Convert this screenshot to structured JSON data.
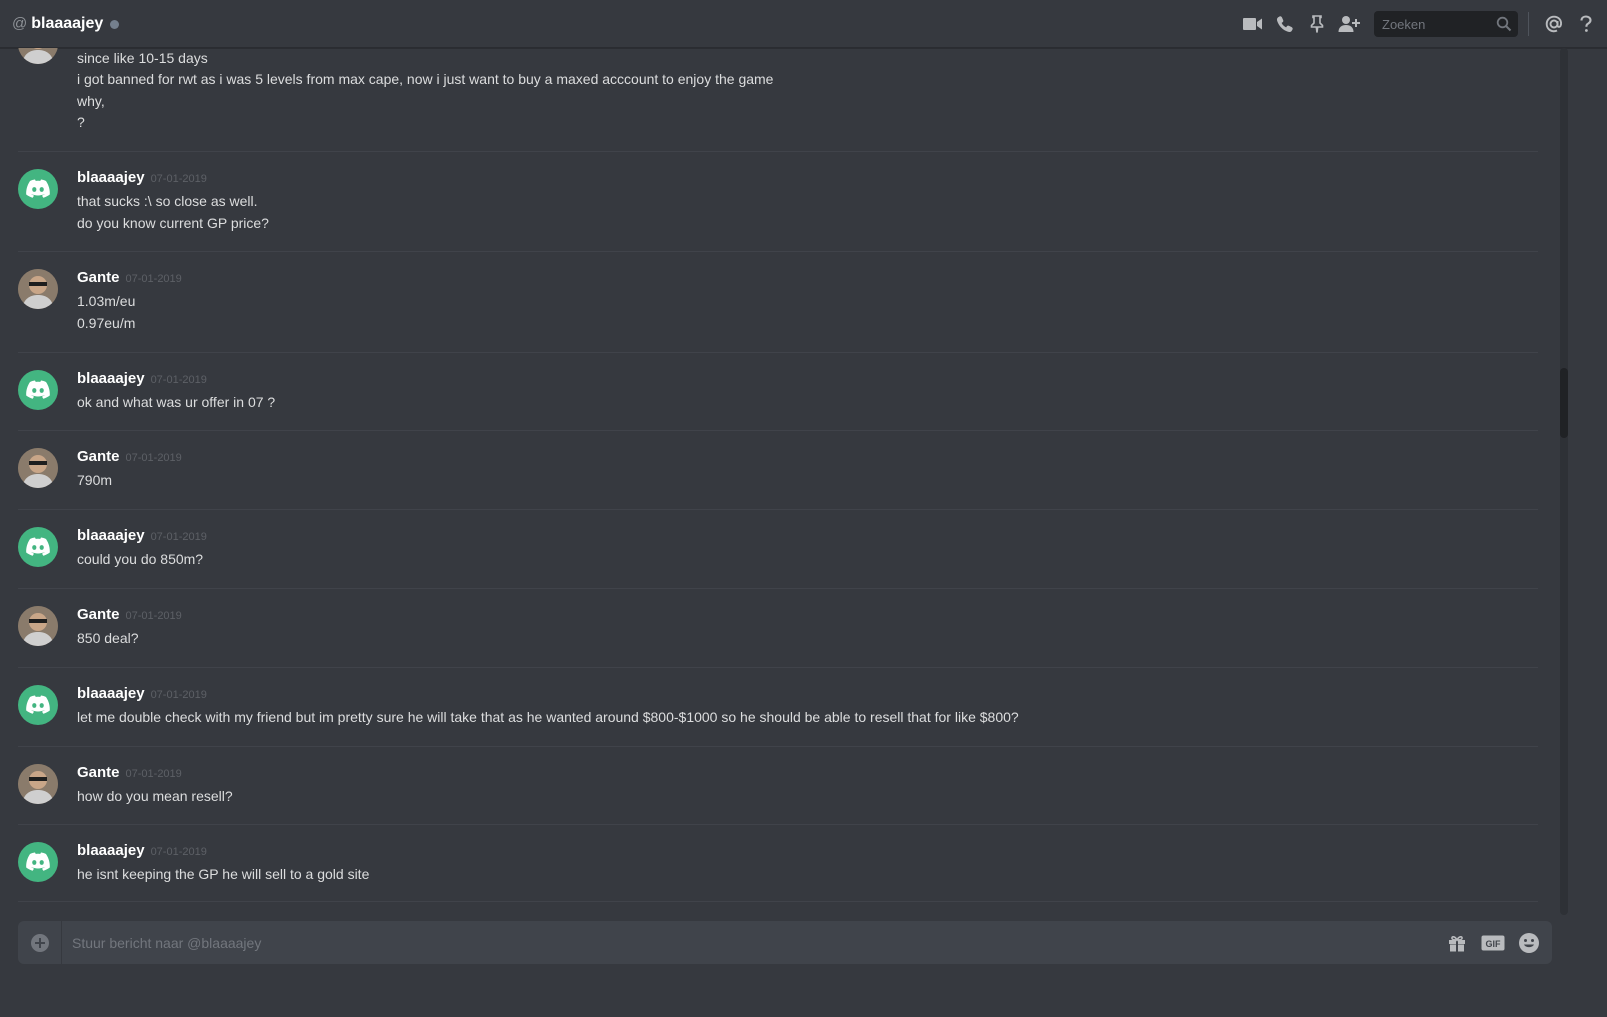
{
  "header": {
    "at_symbol": "@",
    "title": "blaaaajey",
    "search_placeholder": "Zoeken",
    "icons": [
      "video-icon",
      "phone-icon",
      "pin-icon",
      "add-friend-icon",
      "search-icon",
      "mention-icon",
      "help-icon"
    ]
  },
  "colors": {
    "background": "#36393f",
    "header_bg": "#36393f",
    "discord_avatar": "#43b581",
    "username": "#ffffff",
    "timestamp": "#5d6066",
    "message_text": "#dcddde",
    "composer_bg": "#40444b"
  },
  "partial_message": {
    "lines": [
      "since like 10-15 days",
      "i got banned for rwt as i was 5 levels from max cape, now i just want to buy a maxed acccount to enjoy the game",
      "why,",
      "?"
    ]
  },
  "messages": [
    {
      "author": "blaaaajey",
      "timestamp": "07-01-2019",
      "avatar": "discord-logo",
      "lines": [
        "that sucks :\\ so close as well.",
        "do you know current GP price?"
      ]
    },
    {
      "author": "Gante",
      "timestamp": "07-01-2019",
      "avatar": "photo",
      "lines": [
        "1.03m/eu",
        "0.97eu/m"
      ]
    },
    {
      "author": "blaaaajey",
      "timestamp": "07-01-2019",
      "avatar": "discord-logo",
      "lines": [
        "ok and what was ur offer in 07 ?"
      ]
    },
    {
      "author": "Gante",
      "timestamp": "07-01-2019",
      "avatar": "photo",
      "lines": [
        "790m"
      ]
    },
    {
      "author": "blaaaajey",
      "timestamp": "07-01-2019",
      "avatar": "discord-logo",
      "lines": [
        "could you do 850m?"
      ]
    },
    {
      "author": "Gante",
      "timestamp": "07-01-2019",
      "avatar": "photo",
      "lines": [
        "850 deal?"
      ]
    },
    {
      "author": "blaaaajey",
      "timestamp": "07-01-2019",
      "avatar": "discord-logo",
      "lines": [
        "let me double check with my friend but im pretty sure he will take that as he wanted around $800-$1000 so he should be able to resell that for like $800?"
      ]
    },
    {
      "author": "Gante",
      "timestamp": "07-01-2019",
      "avatar": "photo",
      "lines": [
        "how do you mean resell?"
      ]
    },
    {
      "author": "blaaaajey",
      "timestamp": "07-01-2019",
      "avatar": "discord-logo",
      "lines": [
        "he isnt keeping the GP he will sell to a gold site"
      ]
    }
  ],
  "composer": {
    "placeholder": "Stuur bericht naar @blaaaajey",
    "icons": [
      "upload-icon",
      "gift-icon",
      "gif-icon",
      "emoji-icon"
    ]
  }
}
